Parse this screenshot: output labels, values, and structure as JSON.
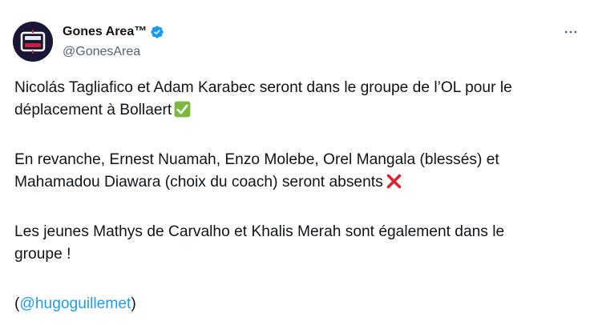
{
  "author": {
    "display_name": "Gones Area™",
    "handle": "@GonesArea",
    "verified": true,
    "avatar_icon": "gones-area-logo-icon"
  },
  "header": {
    "more_icon": "more-options-icon"
  },
  "tweet": {
    "line1": "Nicolás Tagliafico et Adam Karabec seront dans le groupe de l’OL pour le",
    "line2": "déplacement à Bollaert",
    "line3": "En revanche, Ernest Nuamah, Enzo Molebe, Orel Mangala (blessés) et",
    "line4": "Mahamadou Diawara (choix du coach) seront absents",
    "line5": "Les jeunes Mathys de Carvalho et Khalis Merah sont également dans le",
    "line6": "groupe !",
    "mention_open": "(",
    "mention": "@hugoguillemet",
    "mention_close": ")",
    "emoji_check": "check-mark-emoji-icon",
    "emoji_cross": "cross-mark-emoji-icon"
  },
  "colors": {
    "text": "#0f1419",
    "secondary": "#536471",
    "link": "#1d9bf0",
    "verified": "#1d9bf0",
    "check_green": "#7bb93d",
    "cross_red": "#e0202e"
  }
}
